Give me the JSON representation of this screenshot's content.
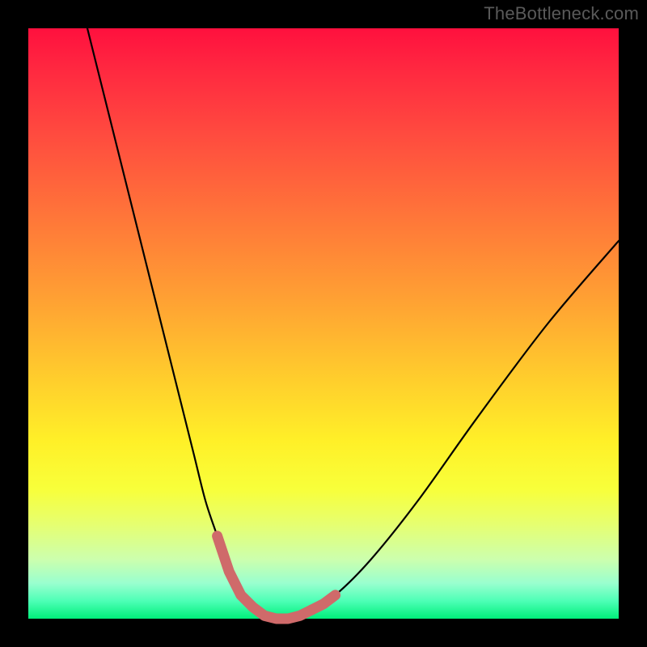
{
  "watermark": "TheBottleneck.com",
  "colors": {
    "background": "#000000",
    "gradient_top": "#ff103e",
    "gradient_mid": "#fff028",
    "gradient_bottom": "#00ef7a",
    "curve_stroke": "#000000",
    "marker_stroke": "#cf6a6a"
  },
  "chart_data": {
    "type": "line",
    "title": "",
    "xlabel": "",
    "ylabel": "",
    "xlim": [
      0,
      100
    ],
    "ylim": [
      0,
      100
    ],
    "grid": false,
    "legend": false,
    "note": "Bottleneck-style V curve. x ≈ relative component score, y ≈ bottleneck % (0 at bottom). Values estimated from pixel positions; no axis labels shown in image.",
    "series": [
      {
        "name": "left-branch",
        "x": [
          10,
          15,
          20,
          25,
          28,
          30,
          32,
          34,
          36,
          38
        ],
        "y": [
          100,
          80,
          60,
          40,
          28,
          20,
          14,
          8,
          4,
          2
        ]
      },
      {
        "name": "trough",
        "x": [
          38,
          40,
          42,
          44,
          46,
          48
        ],
        "y": [
          2,
          0.5,
          0,
          0,
          0.5,
          1.5
        ]
      },
      {
        "name": "right-branch",
        "x": [
          48,
          52,
          58,
          66,
          76,
          88,
          100
        ],
        "y": [
          1.5,
          4,
          10,
          20,
          34,
          50,
          64
        ]
      }
    ],
    "markers": {
      "note": "Thick coral segments near trough on both sides",
      "left": {
        "x": [
          32,
          34,
          36,
          38
        ],
        "y": [
          14,
          8,
          4,
          2
        ]
      },
      "floor": {
        "x": [
          38,
          40,
          42,
          44,
          46,
          48
        ],
        "y": [
          2,
          0.5,
          0,
          0,
          0.5,
          1.5
        ]
      },
      "right": {
        "x": [
          48,
          50,
          52
        ],
        "y": [
          1.5,
          2.5,
          4
        ]
      }
    }
  }
}
